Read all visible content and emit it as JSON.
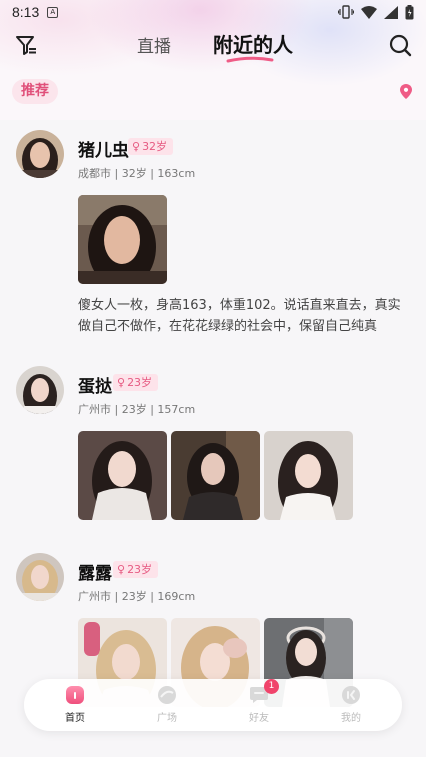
{
  "status_bar": {
    "time": "8:13",
    "app_icon": "A"
  },
  "header": {
    "tabs": [
      {
        "label": "直播"
      },
      {
        "label": "附近的人"
      }
    ]
  },
  "filter_chip": {
    "label": "推荐"
  },
  "colors": {
    "accent": "#e0507a",
    "badge_bg": "#fde3ea",
    "nav_badge": "#f0446b"
  },
  "posts": [
    {
      "name": "猪儿虫",
      "age_badge": "32岁",
      "meta": "成都市 | 32岁 | 163cm",
      "bio": "傻女人一枚，身高163，体重102。说话直来直去，真实做自己不做作，在花花绿绿的社会中，保留自己纯真"
    },
    {
      "name": "蛋挞",
      "age_badge": "23岁",
      "meta": "广州市 | 23岁 | 157cm"
    },
    {
      "name": "露露",
      "age_badge": "23岁",
      "meta": "广州市 | 23岁 | 169cm"
    }
  ],
  "nav": {
    "items": [
      {
        "label": "首页",
        "icon": "home-icon"
      },
      {
        "label": "广场",
        "icon": "square-icon"
      },
      {
        "label": "好友",
        "icon": "chat-icon",
        "badge": "1"
      },
      {
        "label": "我的",
        "icon": "profile-icon"
      }
    ]
  }
}
